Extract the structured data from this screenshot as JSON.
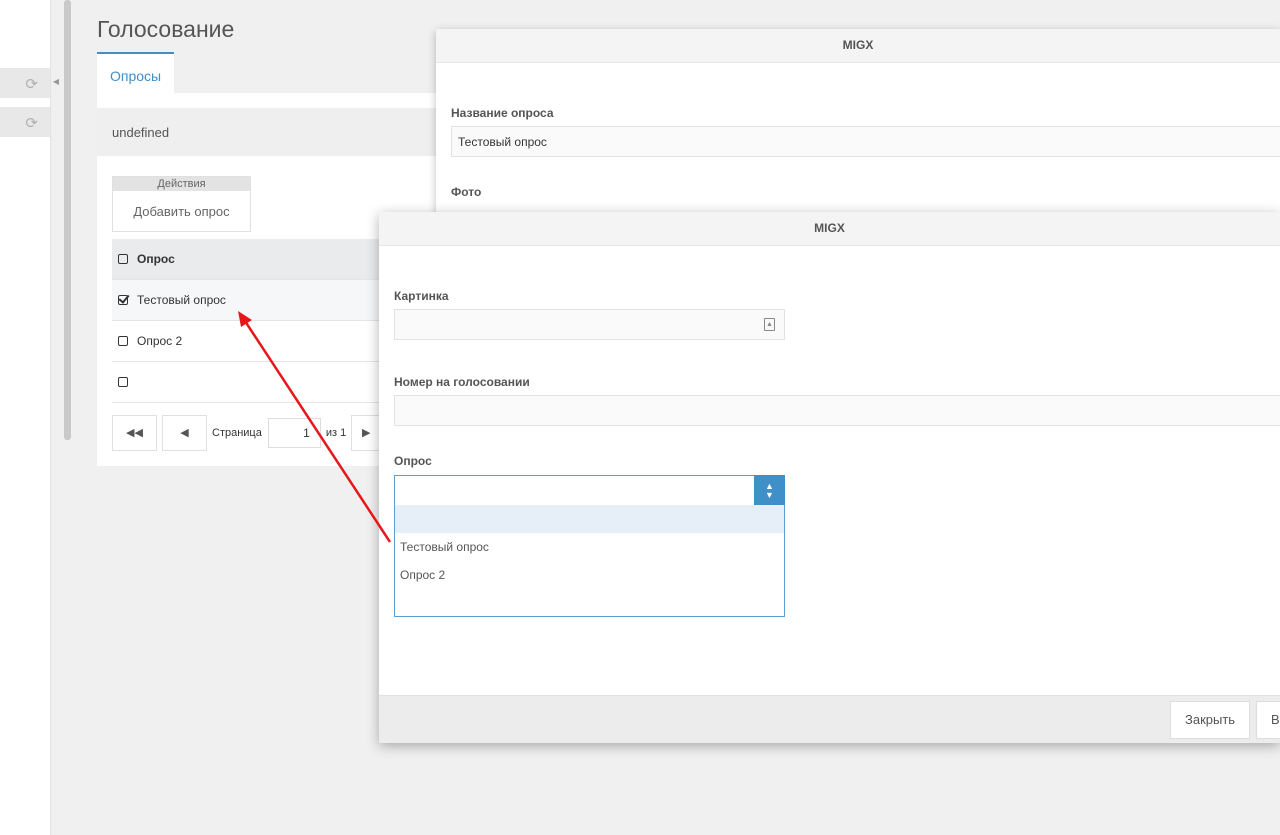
{
  "page": {
    "title": "Голосование",
    "tab_label": "Опросы",
    "undefined_text": "undefined"
  },
  "actions": {
    "header": "Действия",
    "add_button": "Добавить опрос"
  },
  "grid": {
    "column_header": "Опрос",
    "rows": [
      {
        "label": "Тестовый опрос",
        "checked": true
      },
      {
        "label": "Опрос 2",
        "checked": false
      },
      {
        "label": "",
        "checked": false
      }
    ]
  },
  "pager": {
    "page_label": "Страница",
    "page_value": "1",
    "of_label": "из 1"
  },
  "window_back": {
    "title": "MIGX",
    "name_label": "Название опроса",
    "name_value": "Тестовый опрос",
    "photo_label": "Фото"
  },
  "window_front": {
    "title": "MIGX",
    "image_label": "Картинка",
    "number_label": "Номер на голосовании",
    "poll_label": "Опрос",
    "poll_options": [
      "Тестовый опрос",
      "Опрос 2"
    ],
    "close_button": "Закрыть",
    "second_button": "В"
  },
  "icons": {
    "refresh": "refresh-icon",
    "collapse": "triangle-left-icon",
    "first_page": "double-chevron-left-icon",
    "prev_page": "triangle-left-icon",
    "next_page": "triangle-right-icon",
    "image": "image-icon",
    "combo": "up-down-arrows-icon"
  },
  "colors": {
    "accent": "#3f8fc9",
    "annotation_arrow": "#e8151b"
  }
}
